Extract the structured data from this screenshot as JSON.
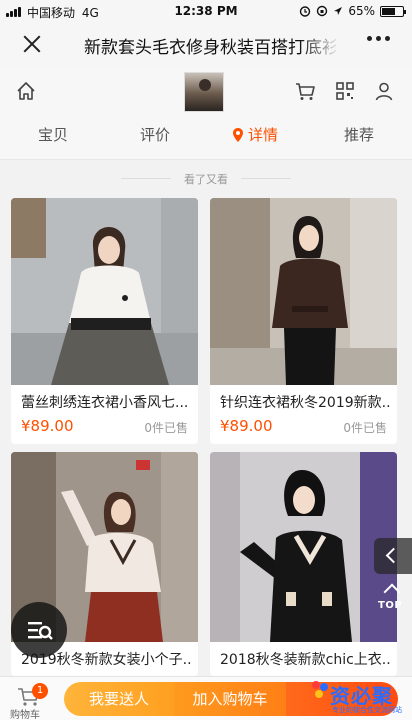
{
  "status_bar": {
    "carrier": "中国移动",
    "network": "4G",
    "time": "12:38 PM",
    "battery_percent": "65%",
    "battery_level": 0.65
  },
  "nav": {
    "title": "新款套头毛衣修身秋装百搭打底衫"
  },
  "tabs": [
    {
      "label": "宝贝"
    },
    {
      "label": "评价"
    },
    {
      "label": "详情",
      "active": true
    },
    {
      "label": "推荐"
    }
  ],
  "section": {
    "label": "看了又看"
  },
  "products": [
    {
      "name": "蕾丝刺绣连衣裙小香风七...",
      "price": "¥89.00",
      "sold": "0件已售"
    },
    {
      "name": "针织连衣裙秋冬2019新款...",
      "price": "¥89.00",
      "sold": "0件已售"
    },
    {
      "name": "2019秋冬新款女装小个子..."
    },
    {
      "name": "2018秋冬装新款chic上衣..."
    }
  ],
  "float": {
    "top_label": "TOP"
  },
  "bottom_bar": {
    "cart_label": "购物车",
    "cart_count": "1",
    "gift_label": "我要送人",
    "add_cart_label": "加入购物车"
  },
  "watermark": {
    "text": "资必聚",
    "subtitle": "专业的综合性交流网站"
  },
  "colors": {
    "accent": "#ff5000",
    "gift": "#ffa020",
    "add_cart": "#ff7f16",
    "buy": "#ff4a10",
    "watermark": "#2a6cff"
  },
  "icons": [
    "home-icon",
    "cart-icon",
    "qr-icon",
    "user-icon",
    "location-pin-icon",
    "close-icon",
    "more-icon",
    "filter-icon",
    "chevron-left-icon",
    "arrow-up-icon"
  ]
}
